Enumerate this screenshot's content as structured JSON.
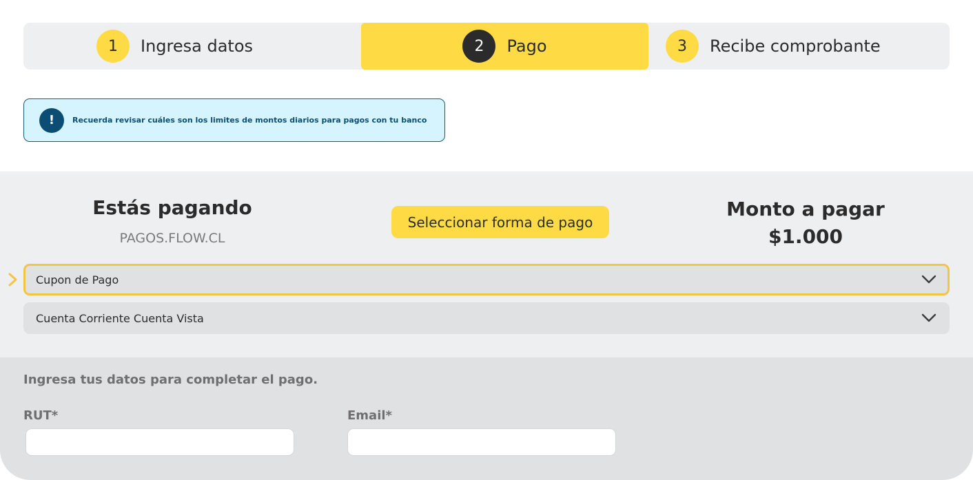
{
  "stepper": {
    "steps": [
      {
        "number": "1",
        "label": "Ingresa datos"
      },
      {
        "number": "2",
        "label": "Pago"
      },
      {
        "number": "3",
        "label": "Recibe comprobante"
      }
    ],
    "active_color": "#fedb45",
    "active_index": 1
  },
  "alert": {
    "icon": "exclamation-icon",
    "text": "Recuerda revisar cuáles son los limites de montos diarios para pagos con tu banco"
  },
  "summary": {
    "paying_title": "Estás pagando",
    "merchant": "PAGOS.FLOW.CL",
    "select_button": "Seleccionar forma de pago",
    "amount_title": "Monto a pagar",
    "amount_value": "$1.000"
  },
  "payment_methods": [
    {
      "label": "Cupon de Pago",
      "selected": true
    },
    {
      "label": "Cuenta Corriente Cuenta Vista",
      "selected": false
    }
  ],
  "form": {
    "intro": "Ingresa tus datos para completar el pago.",
    "rut_label": "RUT*",
    "rut_value": "",
    "email_label": "Email*",
    "email_value": ""
  },
  "colors": {
    "brand_yellow": "#fedb45",
    "alert_bg": "#d6f4fd",
    "alert_fg": "#0c4e73",
    "dark": "#2b2b2b"
  }
}
